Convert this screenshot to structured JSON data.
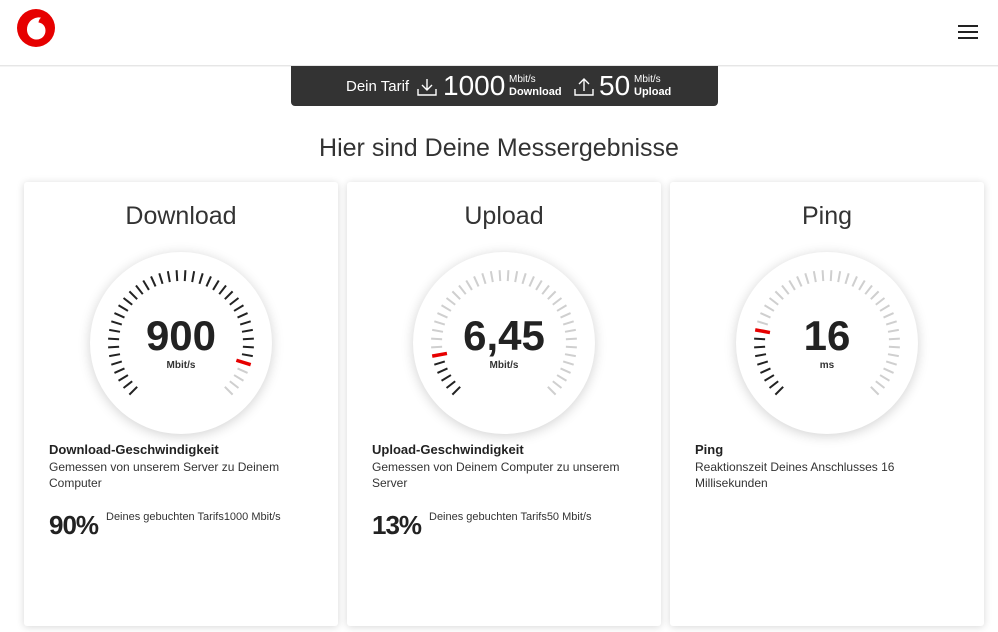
{
  "header": {
    "logo": "vodafone-logo",
    "menu_icon": "hamburger-icon"
  },
  "tarif": {
    "label": "Dein Tarif",
    "download_value": "1000",
    "download_unit": "Mbit/s",
    "download_label": "Download",
    "upload_value": "50",
    "upload_unit": "Mbit/s",
    "upload_label": "Upload"
  },
  "headline": "Hier sind Deine Messergebnisse",
  "accent_color": "#e60000",
  "cards": [
    {
      "title": "Download",
      "value": "900",
      "unit": "Mbit/s",
      "gauge_fraction": 0.9,
      "info_title": "Download-Geschwindigkeit",
      "info_desc": "Gemessen von unserem Server zu Deinem Computer",
      "percent": "90%",
      "percent_text": "Deines gebuchten Tarifs1000 Mbit/s"
    },
    {
      "title": "Upload",
      "value": "6,45",
      "unit": "Mbit/s",
      "gauge_fraction": 0.13,
      "info_title": "Upload-Geschwindigkeit",
      "info_desc": "Gemessen von Deinem Computer zu unserem Server",
      "percent": "13%",
      "percent_text": "Deines gebuchten Tarifs50 Mbit/s"
    },
    {
      "title": "Ping",
      "value": "16",
      "unit": "ms",
      "gauge_fraction": 0.2,
      "info_title": "Ping",
      "info_desc": "Reaktionszeit Deines Anschlusses 16 Millisekunden",
      "percent": "",
      "percent_text": ""
    }
  ]
}
